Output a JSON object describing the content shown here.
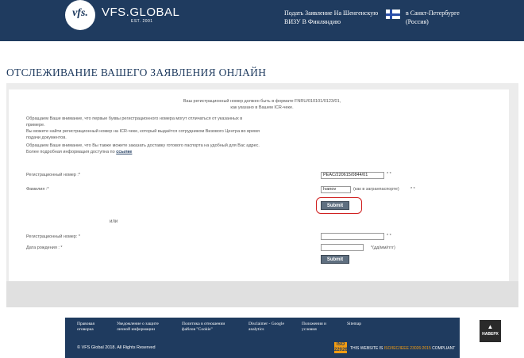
{
  "header": {
    "logo_mark": "vfs.",
    "brand": "VFS.GLOBAL",
    "brand_sub": "EST. 2001",
    "apply_link": "Подать Заявление На Шенгенскую ВИЗУ В Финляндию",
    "city_link": "в Санкт-Петербурге (Россия)",
    "flag_colors": {
      "field": "#ffffff",
      "cross": "#2a4fa8"
    }
  },
  "page_title": "ОТСЛЕЖИВАНИЕ ВАШЕГО ЗАЯВЛЕНИЯ ОНЛАЙН",
  "notes": {
    "format_line1": "Ваш регистрационный номер должен быть в формате FNRU/010101/0123/01,",
    "format_line2": "как указано в Вашем ICR-чеке.",
    "para1_line1": "Обращаем Ваше внимание, что первые буквы регистрационного номера могут отличаться от указанных в",
    "para1_line2": "примере.",
    "para2_line1": "Вы можете найти регистрационный номер на ICR-чеке, который выдаётся сотрудником Визового Центра во время",
    "para2_line2": "подачи документов.",
    "para3_line1": "Обращаем Ваше внимание, что Вы также можете заказать доставку готового паспорта на удобный для Вас адрес.",
    "para3_line2": "Более подробная информация доступна по",
    "link": "ссылке"
  },
  "form1": {
    "reg_label": "Регистрационный номер :*",
    "reg_value": "PEAC/220615/0844/01",
    "surname_label": "Фамилия :*",
    "surname_value": "Ivanov",
    "surname_hint": "(как в загранпаспорте)",
    "required_mark": "* *",
    "submit": "Submit"
  },
  "divider": "или",
  "form2": {
    "reg_label": "Регистрационный номер: *",
    "reg_value": "",
    "dob_label": "Дата рождения : *",
    "dob_value": "",
    "dob_hint": "*(дд/мм/гггг)",
    "required_mark": "* *",
    "submit": "Submit"
  },
  "footer": {
    "links": [
      "Правовая оговорка",
      "Уведомление о защите личной информации",
      "Политика в отношении файлов \"Cookie\"",
      "Disclaimer - Google analytics",
      "Положения и условия",
      "Sitemap"
    ],
    "copyright": "© VFS Global 2018. All Rights Reserved",
    "iso_badge_top": "ISO",
    "iso_badge_bottom": "22026",
    "iso_prefix": "THIS WEBSITE IS",
    "iso_standard": "ISO/IEC/IEEE 23026:2015",
    "iso_suffix": "COMPLIANT"
  },
  "back_to_top": {
    "arrow": "▲",
    "label": "НАВЕРХ"
  },
  "colors": {
    "brand": "#1f3b5f",
    "button": "#5f6f80",
    "highlight": "#d01f1f",
    "panel": "#ececec"
  }
}
